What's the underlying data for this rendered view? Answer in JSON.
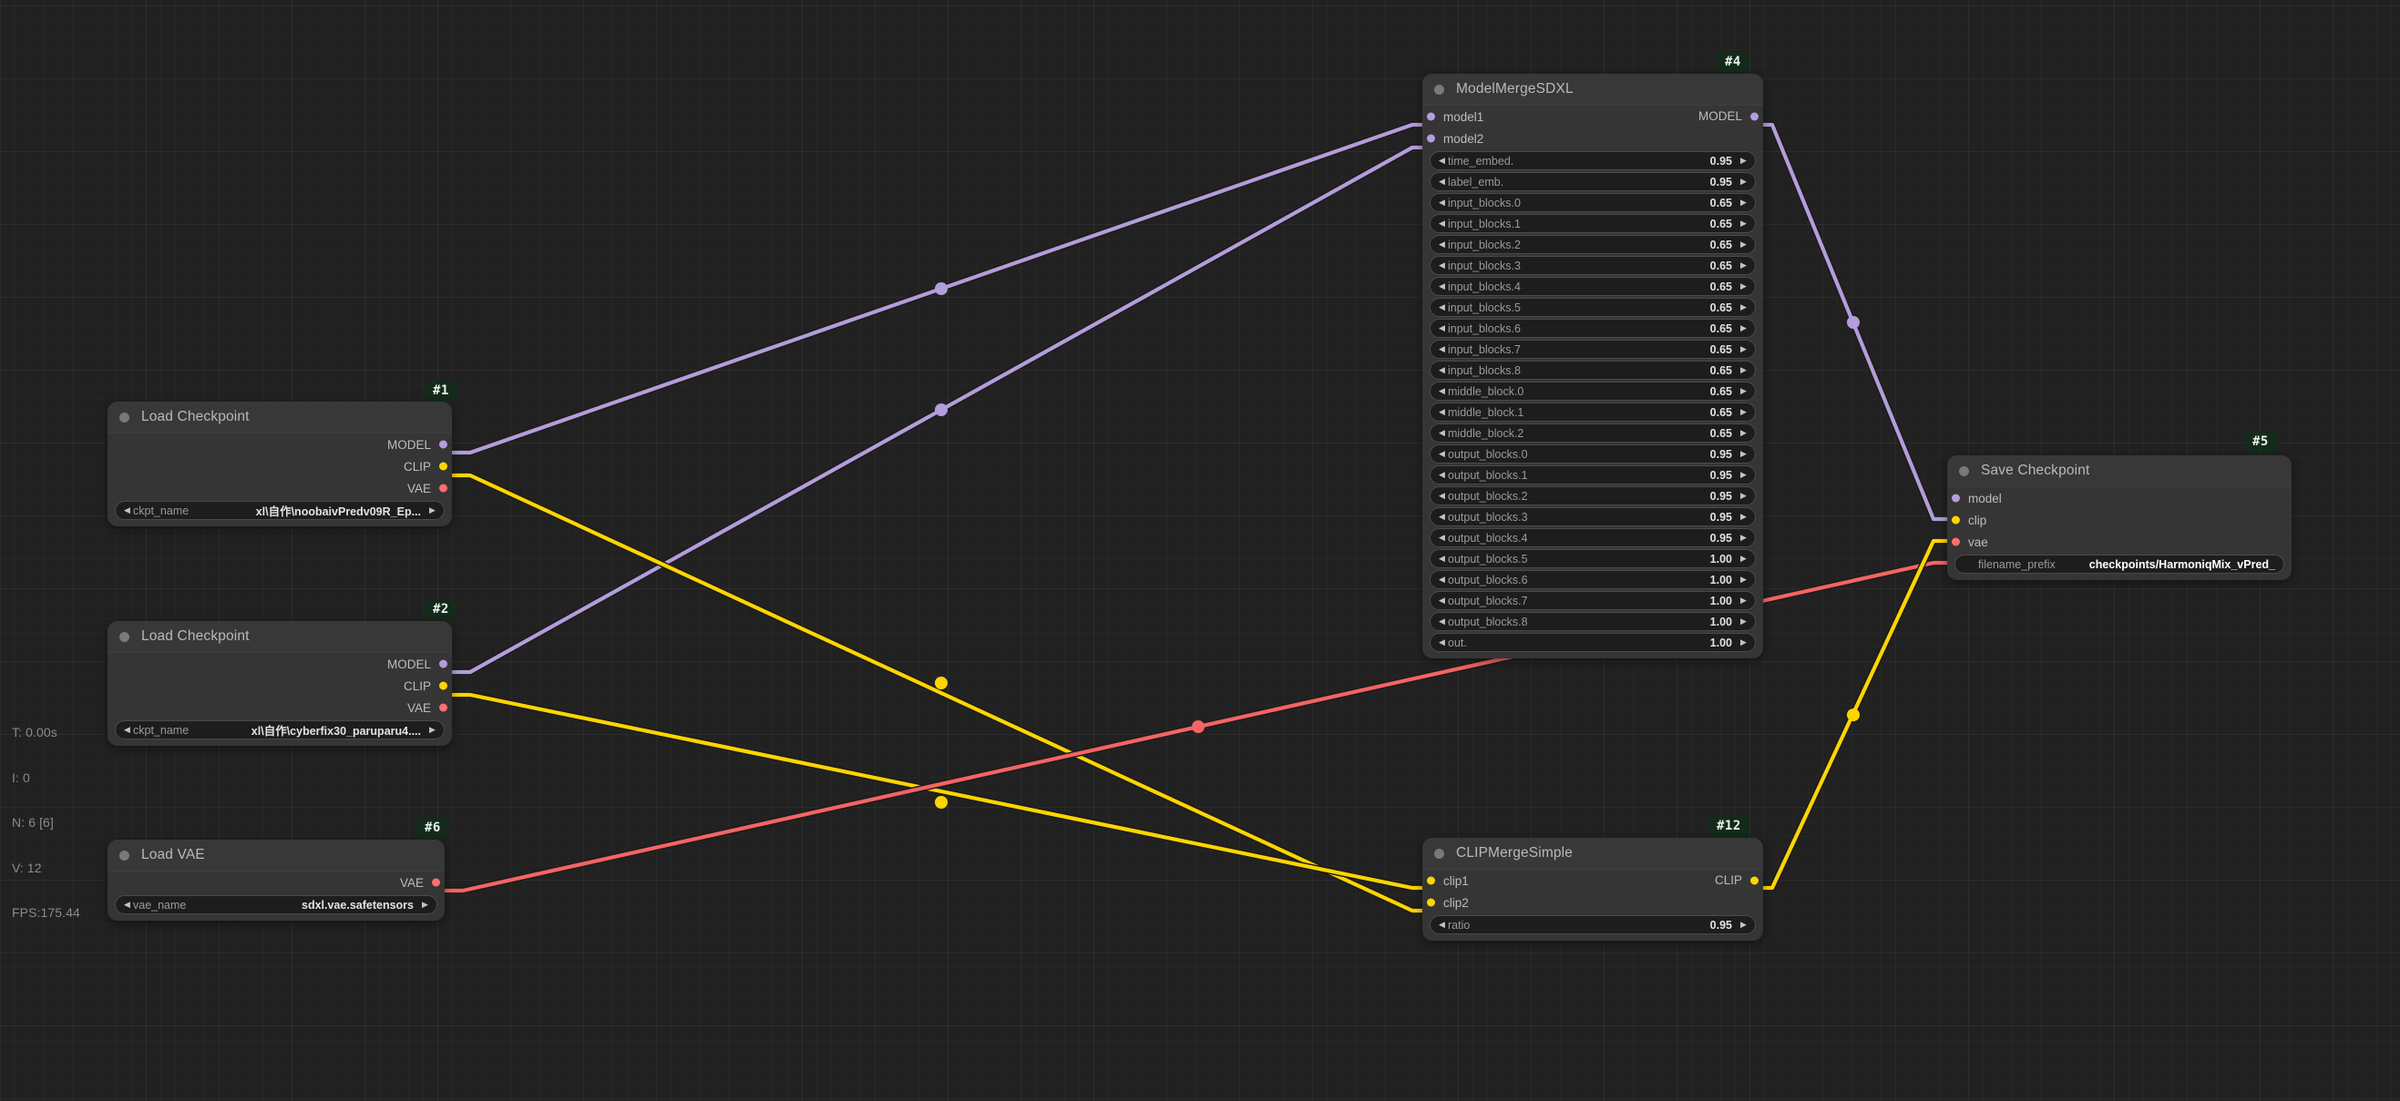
{
  "app": {
    "type": "node-graph-editor",
    "canvas_bg": "#212121",
    "grid_color": "#2a2a2a"
  },
  "stats": {
    "time": "T: 0.00s",
    "iterations": "I: 0",
    "nodes": "N: 6 [6]",
    "vertices": "V: 12",
    "fps": "FPS:175.44"
  },
  "colors": {
    "model_link": "#b39ddb",
    "clip_link": "#ffd500",
    "vae_link": "#f56464",
    "node_body": "#353535",
    "node_header": "#383838",
    "badge_bg": "#142a1b"
  },
  "nodes": [
    {
      "id": "1",
      "badge": "#1",
      "title": "Load Checkpoint",
      "inputs": [],
      "outputs": [
        {
          "label": "MODEL",
          "type": "model"
        },
        {
          "label": "CLIP",
          "type": "clip"
        },
        {
          "label": "VAE",
          "type": "vae"
        }
      ],
      "widgets": [
        {
          "kind": "combo",
          "name": "ckpt_name",
          "value": "xl\\自作\\noobaivPredv09R_Ep..."
        }
      ]
    },
    {
      "id": "2",
      "badge": "#2",
      "title": "Load Checkpoint",
      "inputs": [],
      "outputs": [
        {
          "label": "MODEL",
          "type": "model"
        },
        {
          "label": "CLIP",
          "type": "clip"
        },
        {
          "label": "VAE",
          "type": "vae"
        }
      ],
      "widgets": [
        {
          "kind": "combo",
          "name": "ckpt_name",
          "value": "xl\\自作\\cyberfix30_paruparu4...."
        }
      ]
    },
    {
      "id": "6",
      "badge": "#6",
      "title": "Load VAE",
      "inputs": [],
      "outputs": [
        {
          "label": "VAE",
          "type": "vae"
        }
      ],
      "widgets": [
        {
          "kind": "combo",
          "name": "vae_name",
          "value": "sdxl.vae.safetensors"
        }
      ]
    },
    {
      "id": "4",
      "badge": "#4",
      "title": "ModelMergeSDXL",
      "inputs": [
        {
          "label": "model1",
          "type": "model"
        },
        {
          "label": "model2",
          "type": "model"
        }
      ],
      "outputs": [
        {
          "label": "MODEL",
          "type": "model"
        }
      ],
      "widgets": [
        {
          "kind": "number",
          "name": "time_embed.",
          "value": "0.95"
        },
        {
          "kind": "number",
          "name": "label_emb.",
          "value": "0.95"
        },
        {
          "kind": "number",
          "name": "input_blocks.0",
          "value": "0.65"
        },
        {
          "kind": "number",
          "name": "input_blocks.1",
          "value": "0.65"
        },
        {
          "kind": "number",
          "name": "input_blocks.2",
          "value": "0.65"
        },
        {
          "kind": "number",
          "name": "input_blocks.3",
          "value": "0.65"
        },
        {
          "kind": "number",
          "name": "input_blocks.4",
          "value": "0.65"
        },
        {
          "kind": "number",
          "name": "input_blocks.5",
          "value": "0.65"
        },
        {
          "kind": "number",
          "name": "input_blocks.6",
          "value": "0.65"
        },
        {
          "kind": "number",
          "name": "input_blocks.7",
          "value": "0.65"
        },
        {
          "kind": "number",
          "name": "input_blocks.8",
          "value": "0.65"
        },
        {
          "kind": "number",
          "name": "middle_block.0",
          "value": "0.65"
        },
        {
          "kind": "number",
          "name": "middle_block.1",
          "value": "0.65"
        },
        {
          "kind": "number",
          "name": "middle_block.2",
          "value": "0.65"
        },
        {
          "kind": "number",
          "name": "output_blocks.0",
          "value": "0.95"
        },
        {
          "kind": "number",
          "name": "output_blocks.1",
          "value": "0.95"
        },
        {
          "kind": "number",
          "name": "output_blocks.2",
          "value": "0.95"
        },
        {
          "kind": "number",
          "name": "output_blocks.3",
          "value": "0.95"
        },
        {
          "kind": "number",
          "name": "output_blocks.4",
          "value": "0.95"
        },
        {
          "kind": "number",
          "name": "output_blocks.5",
          "value": "1.00"
        },
        {
          "kind": "number",
          "name": "output_blocks.6",
          "value": "1.00"
        },
        {
          "kind": "number",
          "name": "output_blocks.7",
          "value": "1.00"
        },
        {
          "kind": "number",
          "name": "output_blocks.8",
          "value": "1.00"
        },
        {
          "kind": "number",
          "name": "out.",
          "value": "1.00"
        }
      ]
    },
    {
      "id": "12",
      "badge": "#12",
      "title": "CLIPMergeSimple",
      "inputs": [
        {
          "label": "clip1",
          "type": "clip"
        },
        {
          "label": "clip2",
          "type": "clip"
        }
      ],
      "outputs": [
        {
          "label": "CLIP",
          "type": "clip"
        }
      ],
      "widgets": [
        {
          "kind": "number",
          "name": "ratio",
          "value": "0.95"
        }
      ]
    },
    {
      "id": "5",
      "badge": "#5",
      "title": "Save Checkpoint",
      "inputs": [
        {
          "label": "model",
          "type": "model"
        },
        {
          "label": "clip",
          "type": "clip"
        },
        {
          "label": "vae",
          "type": "vae"
        }
      ],
      "outputs": [],
      "widgets": [
        {
          "kind": "text",
          "name": "filename_prefix",
          "value": "checkpoints/HarmoniqMix_vPred_"
        }
      ]
    }
  ],
  "links": [
    {
      "from": "1.MODEL",
      "to": "4.model1",
      "type": "model"
    },
    {
      "from": "2.MODEL",
      "to": "4.model2",
      "type": "model"
    },
    {
      "from": "1.CLIP",
      "to": "12.clip2",
      "type": "clip"
    },
    {
      "from": "2.CLIP",
      "to": "12.clip1",
      "type": "clip"
    },
    {
      "from": "6.VAE",
      "to": "5.vae",
      "type": "vae"
    },
    {
      "from": "4.MODEL",
      "to": "5.model",
      "type": "model"
    },
    {
      "from": "12.CLIP",
      "to": "5.clip",
      "type": "clip"
    }
  ]
}
